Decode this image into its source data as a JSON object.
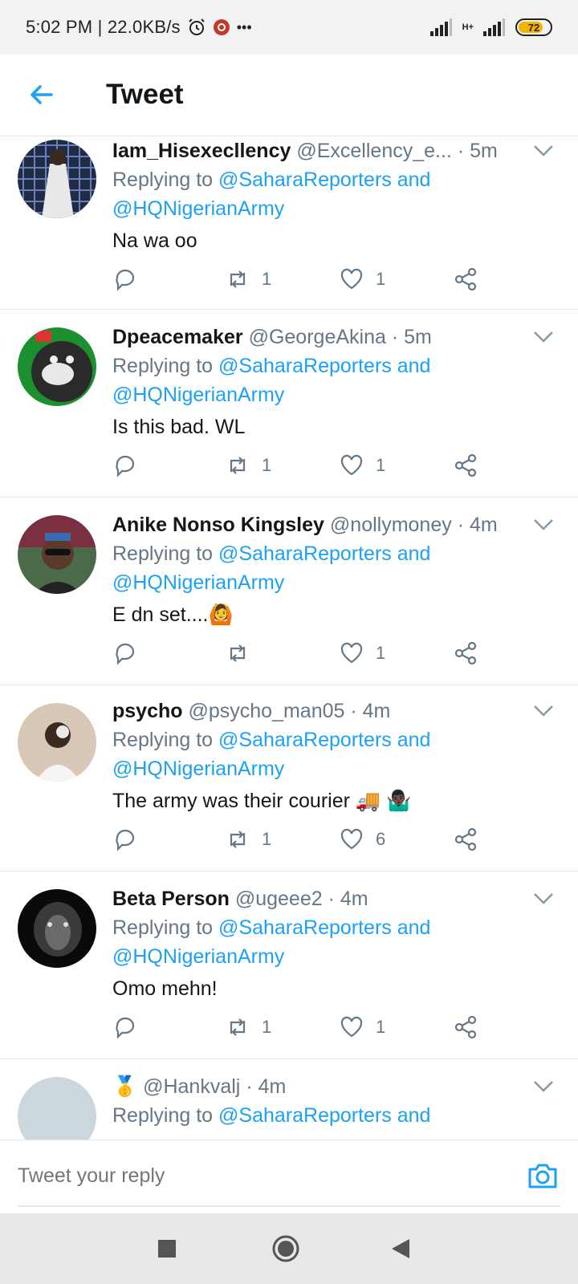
{
  "status_bar": {
    "time": "5:02 PM | 22.0KB/s",
    "more": "•••",
    "network": "H+",
    "battery": "72"
  },
  "header": {
    "title": "Tweet"
  },
  "tweets": [
    {
      "name": "Iam_Hisexecllency",
      "handle": "@Excellency_e...",
      "time": "· 5m",
      "replying_prefix": "Replying to",
      "mention1": "@SaharaReporters",
      "and": "and",
      "mention2": "@HQNigerianArmy",
      "text": "Na wa oo",
      "retweets": "1",
      "likes": "1"
    },
    {
      "name": "Dpeacemaker",
      "handle": "@GeorgeAkina",
      "time": "· 5m",
      "replying_prefix": "Replying to",
      "mention1": "@SaharaReporters",
      "and": "and",
      "mention2": "@HQNigerianArmy",
      "text": "Is this bad. WL",
      "retweets": "1",
      "likes": "1"
    },
    {
      "name": "Anike Nonso Kingsley",
      "handle": "@nollymoney",
      "time": "· 4m",
      "replying_prefix": "Replying to",
      "mention1": "@SaharaReporters",
      "and": "and",
      "mention2": "@HQNigerianArmy",
      "text": "E dn set....🙆",
      "retweets": "",
      "likes": "1"
    },
    {
      "name": "psycho",
      "handle": "@psycho_man05",
      "time": "· 4m",
      "replying_prefix": "Replying to",
      "mention1": "@SaharaReporters",
      "and": "and",
      "mention2": "@HQNigerianArmy",
      "text": "The army was their courier 🚚 🤷🏿‍♂️",
      "retweets": "1",
      "likes": "6"
    },
    {
      "name": "Beta Person",
      "handle": "@ugeee2",
      "time": "· 4m",
      "replying_prefix": "Replying to",
      "mention1": "@SaharaReporters",
      "and": "and",
      "mention2": "@HQNigerianArmy",
      "text": "Omo mehn!",
      "retweets": "1",
      "likes": "1"
    },
    {
      "name": "🥇",
      "handle": "@Hankvalj",
      "time": "· 4m",
      "replying_prefix": "Replying to",
      "mention1": "@SaharaReporters",
      "and": "and",
      "mention2": "",
      "text": "",
      "retweets": "",
      "likes": ""
    }
  ],
  "reply_bar": {
    "placeholder": "Tweet your reply"
  },
  "colors": {
    "accent": "#1da1f2",
    "muted": "#657786",
    "text": "#14171a",
    "divider": "#e1e8ed"
  },
  "icons": [
    "back-arrow-icon",
    "chevron-down-icon",
    "reply-icon",
    "retweet-icon",
    "like-icon",
    "share-icon",
    "camera-icon",
    "alarm-icon",
    "nav-recents-icon",
    "nav-home-icon",
    "nav-back-icon"
  ]
}
